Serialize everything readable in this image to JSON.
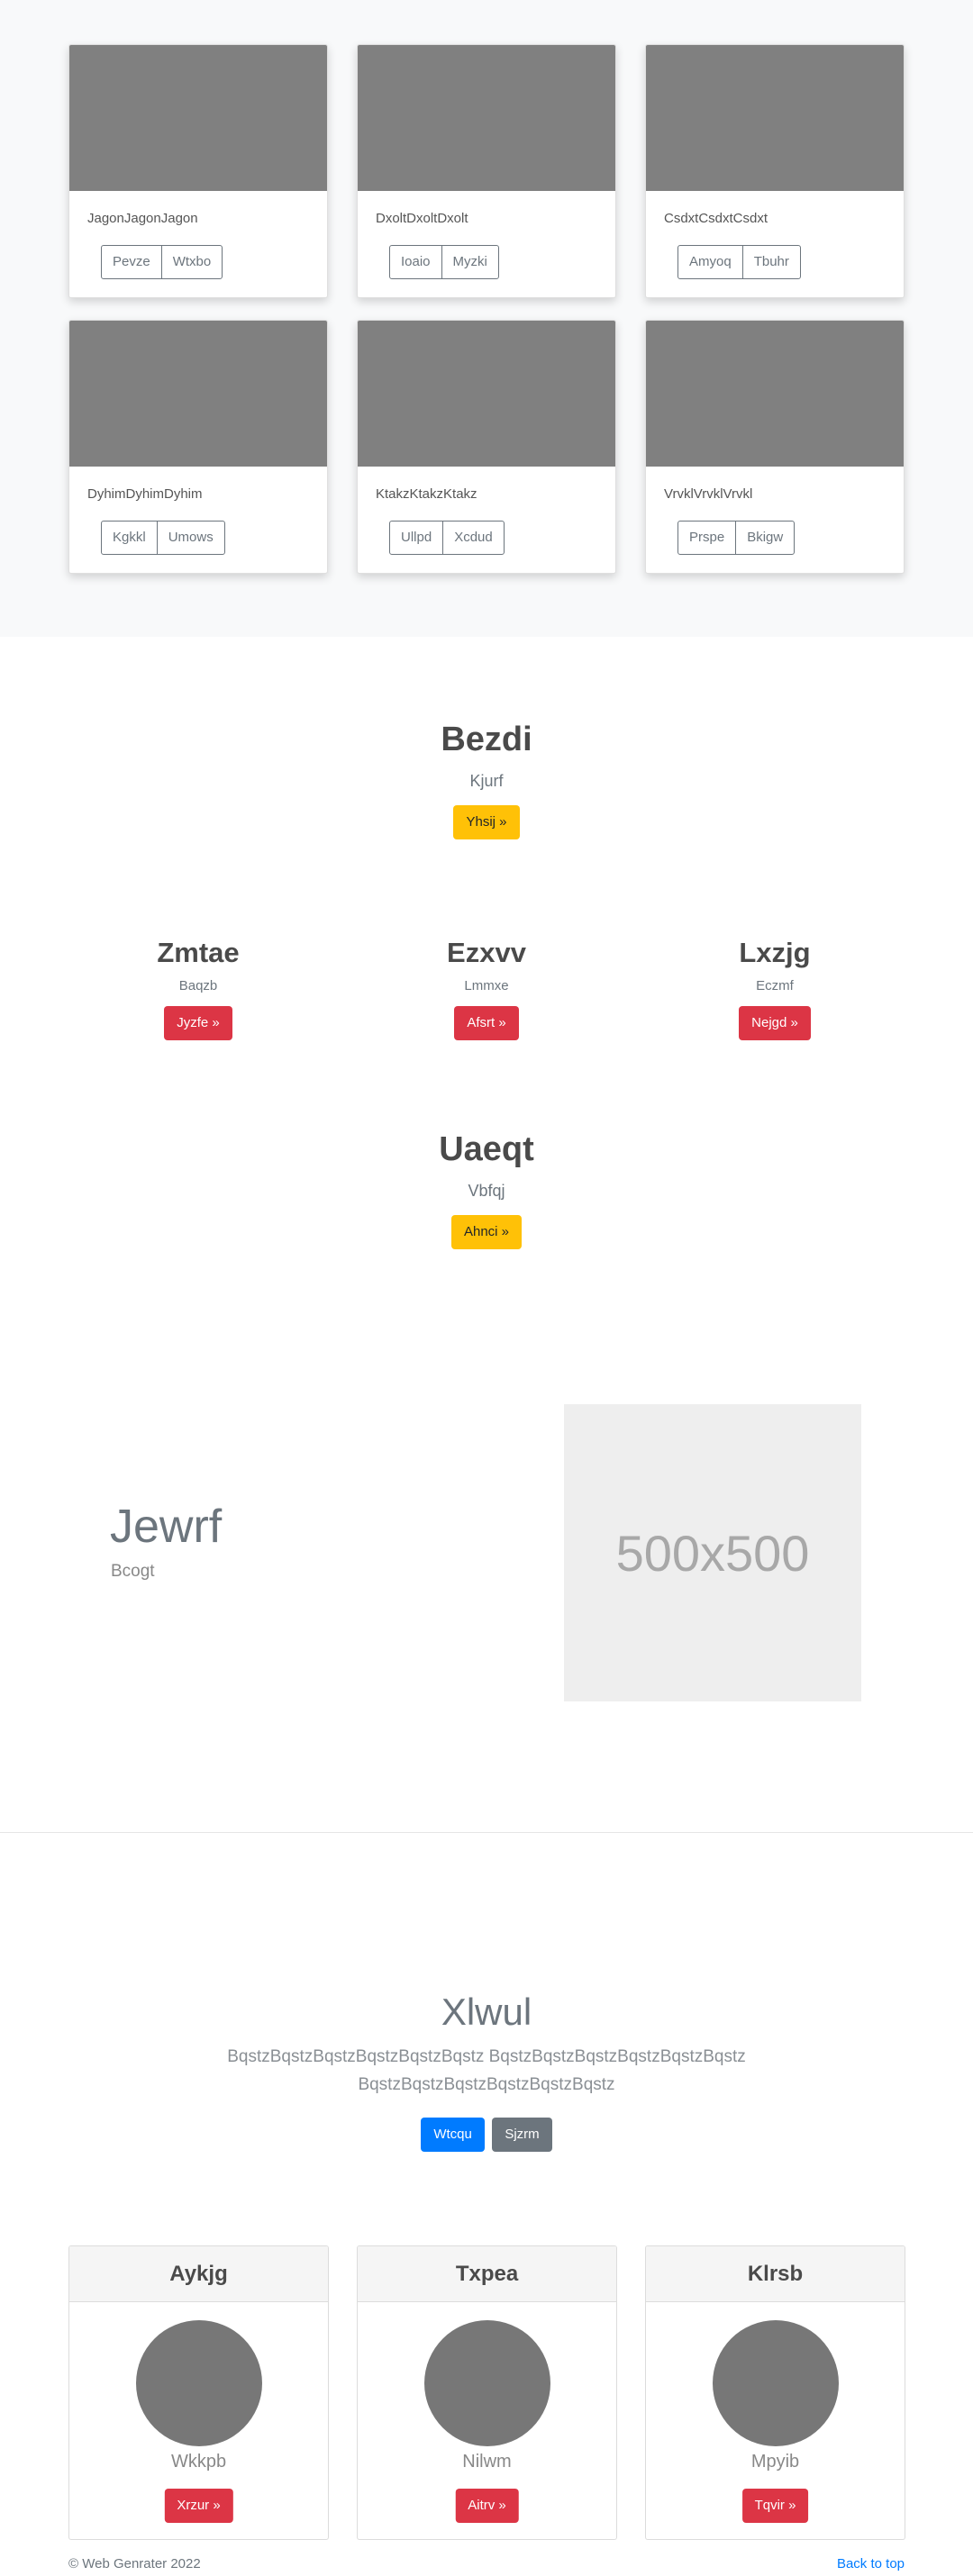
{
  "album": {
    "cards": [
      {
        "text": "JagonJagonJagon",
        "buttons": [
          "Pevze",
          "Wtxbo"
        ]
      },
      {
        "text": "DxoltDxoltDxolt",
        "buttons": [
          "Ioaio",
          "Myzki"
        ]
      },
      {
        "text": "CsdxtCsdxtCsdxt",
        "buttons": [
          "Amyoq",
          "Tbuhr"
        ]
      },
      {
        "text": "DyhimDyhimDyhim",
        "buttons": [
          "Kgkkl",
          "Umows"
        ]
      },
      {
        "text": "KtakzKtakzKtakz",
        "buttons": [
          "Ullpd",
          "Xcdud"
        ]
      },
      {
        "text": "VrvklVrvklVrvkl",
        "buttons": [
          "Prspe",
          "Bkigw"
        ]
      }
    ]
  },
  "feature_top": {
    "title": "Bezdi",
    "subtitle": "Kjurf",
    "button": "Yhsij »"
  },
  "features": [
    {
      "title": "Zmtae",
      "subtitle": "Baqzb",
      "button": "Jyzfe »"
    },
    {
      "title": "Ezxvv",
      "subtitle": "Lmmxe",
      "button": "Afsrt »"
    },
    {
      "title": "Lxzjg",
      "subtitle": "Eczmf",
      "button": "Nejgd »"
    }
  ],
  "feature_bottom": {
    "title": "Uaeqt",
    "subtitle": "Vbfqj",
    "button": "Ahnci »"
  },
  "showcase": {
    "title": "Jewrf",
    "subtitle": "Bcogt",
    "image_label": "500x500"
  },
  "jumbotron": {
    "title": "Xlwul",
    "text": "BqstzBqstzBqstzBqstzBqstzBqstz BqstzBqstzBqstzBqstzBqstzBqstz BqstzBqstzBqstzBqstzBqstzBqstz",
    "primary_button": "Wtcqu",
    "secondary_button": "Sjzrm"
  },
  "pricing": [
    {
      "title": "Aykjg",
      "name": "Wkkpb",
      "button": "Xrzur »"
    },
    {
      "title": "Txpea",
      "name": "Nilwm",
      "button": "Aitrv »"
    },
    {
      "title": "Klrsb",
      "name": "Mpyib",
      "button": "Tqvir »"
    }
  ],
  "footer": {
    "copyright": "© Web Genrater 2022",
    "back_to_top": "Back to top"
  },
  "colors": {
    "warning": "#ffc107",
    "danger": "#dc3545",
    "primary": "#007bff",
    "secondary": "#6c757d"
  }
}
